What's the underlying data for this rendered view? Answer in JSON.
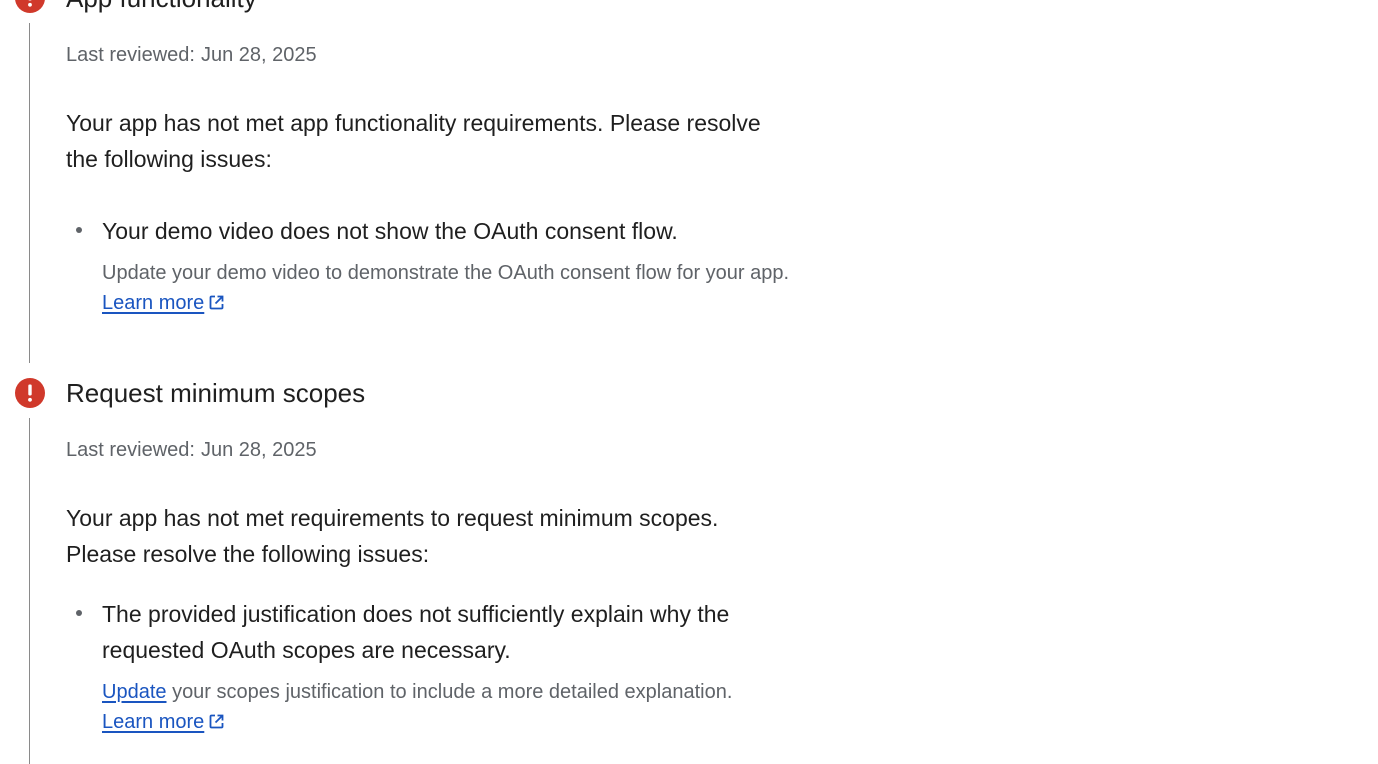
{
  "colors": {
    "error_red": "#d0392b",
    "link_blue": "#1a55c0",
    "secondary_text": "#5f6368",
    "primary_text": "#1f1f1f",
    "timeline": "#8a8a8a"
  },
  "sections": [
    {
      "icon": "error-icon",
      "title": "App functionality",
      "last_reviewed_label": "Last reviewed:",
      "last_reviewed_date": "Jun 28, 2025",
      "summary": "Your app has not met app functionality requirements. Please resolve the following issues:",
      "issues": [
        {
          "title": "Your demo video does not show the OAuth consent flow.",
          "description": "Update your demo video to demonstrate the OAuth consent flow for your app.",
          "learn_more": "Learn more",
          "learn_more_icon": "external-link-icon"
        }
      ]
    },
    {
      "icon": "error-icon",
      "title": "Request minimum scopes",
      "last_reviewed_label": "Last reviewed:",
      "last_reviewed_date": "Jun 28, 2025",
      "summary": "Your app has not met requirements to request minimum scopes. Please resolve the following issues:",
      "issues": [
        {
          "title": "The provided justification does not sufficiently explain why the requested OAuth scopes are necessary.",
          "update_link": "Update",
          "description_rest": "your scopes justification to include a more detailed explanation.",
          "learn_more": "Learn more",
          "learn_more_icon": "external-link-icon"
        }
      ]
    }
  ]
}
